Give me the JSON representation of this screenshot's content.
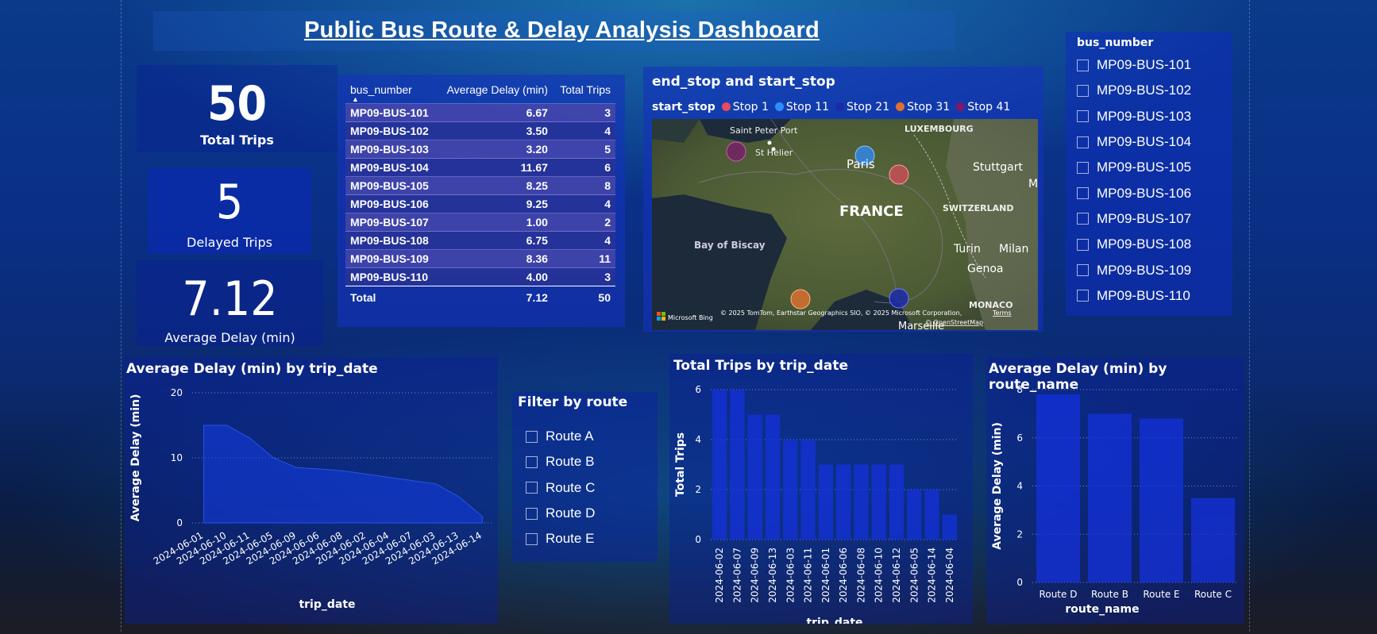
{
  "dashboard": {
    "title": "Public Bus Route & Delay Analysis Dashboard"
  },
  "kpis": {
    "total_trips": {
      "value": "50",
      "label": "Total Trips"
    },
    "delayed_trips": {
      "value": "5",
      "label": "Delayed Trips"
    },
    "avg_delay": {
      "value": "7.12",
      "label": "Average Delay (min)"
    }
  },
  "table": {
    "headers": [
      "bus_number",
      "Average Delay (min)",
      "Total Trips"
    ],
    "rows": [
      [
        "MP09-BUS-101",
        "6.67",
        "3"
      ],
      [
        "MP09-BUS-102",
        "3.50",
        "4"
      ],
      [
        "MP09-BUS-103",
        "3.20",
        "5"
      ],
      [
        "MP09-BUS-104",
        "11.67",
        "6"
      ],
      [
        "MP09-BUS-105",
        "8.25",
        "8"
      ],
      [
        "MP09-BUS-106",
        "9.25",
        "4"
      ],
      [
        "MP09-BUS-107",
        "1.00",
        "2"
      ],
      [
        "MP09-BUS-108",
        "6.75",
        "4"
      ],
      [
        "MP09-BUS-109",
        "8.36",
        "11"
      ],
      [
        "MP09-BUS-110",
        "4.00",
        "3"
      ]
    ],
    "total": [
      "Total",
      "7.12",
      "50"
    ]
  },
  "map": {
    "title": "end_stop and start_stop",
    "legend_title": "start_stop",
    "legend": [
      {
        "name": "Stop 1",
        "color": "#e84a5f"
      },
      {
        "name": "Stop 11",
        "color": "#2f8cff"
      },
      {
        "name": "Stop 21",
        "color": "#1b2aa8"
      },
      {
        "name": "Stop 31",
        "color": "#e07030"
      },
      {
        "name": "Stop 41",
        "color": "#7a1a6a"
      }
    ],
    "labels": {
      "saint_peter_port": "Saint Peter Port",
      "st_helier": "St Helier",
      "paris": "Paris",
      "luxembourg": "LUXEMBOURG",
      "stuttgart": "Stuttgart",
      "m": "M",
      "france": "FRANCE",
      "switzerland": "SWITZERLAND",
      "bay_of_biscay": "Bay of Biscay",
      "turin": "Turin",
      "milan": "Milan",
      "genoa": "Genoa",
      "monaco": "MONACO",
      "marseille": "Marseille"
    },
    "attribution": "© 2025 TomTom, Earthstar Geographics SIO, © 2025 Microsoft Corporation,",
    "terms": "Terms",
    "osm": "© OpenStreetMap",
    "bing": "Microsoft Bing"
  },
  "bus_slicer": {
    "title": "bus_number",
    "items": [
      "MP09-BUS-101",
      "MP09-BUS-102",
      "MP09-BUS-103",
      "MP09-BUS-104",
      "MP09-BUS-105",
      "MP09-BUS-106",
      "MP09-BUS-107",
      "MP09-BUS-108",
      "MP09-BUS-109",
      "MP09-BUS-110"
    ]
  },
  "route_slicer": {
    "title": "Filter by route",
    "items": [
      "Route A",
      "Route B",
      "Route C",
      "Route D",
      "Route E"
    ]
  },
  "chart_data": [
    {
      "type": "area",
      "title": "Average Delay (min) by trip_date",
      "xlabel": "trip_date",
      "ylabel": "Average Delay (min)",
      "ylim": [
        0,
        20
      ],
      "yticks": [
        0,
        10,
        20
      ],
      "categories": [
        "2024-06-01",
        "2024-06-10",
        "2024-06-11",
        "2024-06-05",
        "2024-06-09",
        "2024-06-06",
        "2024-06-08",
        "2024-06-02",
        "2024-06-04",
        "2024-06-07",
        "2024-06-03",
        "2024-06-13",
        "2024-06-14"
      ],
      "values": [
        15,
        15,
        13,
        10,
        8.5,
        8.3,
        8,
        7.5,
        7,
        6.5,
        6,
        4,
        1
      ]
    },
    {
      "type": "bar",
      "title": "Total Trips by trip_date",
      "xlabel": "trip_date",
      "ylabel": "Total Trips",
      "ylim": [
        0,
        6
      ],
      "yticks": [
        0,
        2,
        4,
        6
      ],
      "categories": [
        "2024-06-02",
        "2024-06-07",
        "2024-06-09",
        "2024-06-13",
        "2024-06-03",
        "2024-06-11",
        "2024-06-01",
        "2024-06-06",
        "2024-06-08",
        "2024-06-10",
        "2024-06-12",
        "2024-06-05",
        "2024-06-14",
        "2024-06-04"
      ],
      "values": [
        6,
        6,
        5,
        5,
        4,
        4,
        3,
        3,
        3,
        3,
        3,
        2,
        2,
        1
      ]
    },
    {
      "type": "bar",
      "title": "Average Delay (min) by route_name",
      "xlabel": "route_name",
      "ylabel": "Average Delay (min)",
      "ylim": [
        0,
        8
      ],
      "yticks": [
        0,
        2,
        4,
        6,
        8
      ],
      "categories": [
        "Route D",
        "Route B",
        "Route E",
        "Route C"
      ],
      "values": [
        7.8,
        7.0,
        6.8,
        3.5
      ]
    }
  ]
}
